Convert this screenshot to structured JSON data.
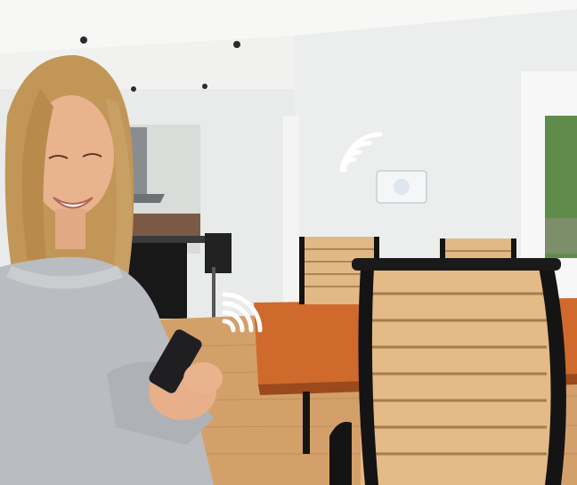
{
  "scene": {
    "description_icons": [
      "wifi-signal-icon",
      "wifi-signal-icon"
    ],
    "colors": {
      "wall": "#e9ecea",
      "ceiling": "#f3f4f2",
      "floor": "#d7a36c",
      "table": "#cf6a2c",
      "chair_frame": "#141414",
      "chair_slats": "#e4ba86",
      "sweater": "#b9bcc0",
      "hair": "#c49a5e",
      "skin": "#e8b48e",
      "window_green": "#5f8c4a",
      "thermostat": "#f4f6f8",
      "wifi": "#ffffff"
    }
  }
}
